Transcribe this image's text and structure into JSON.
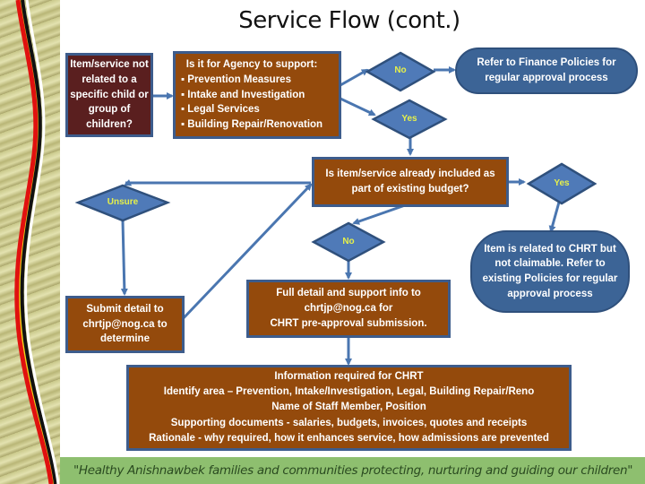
{
  "title": "Service Flow (cont.)",
  "colors": {
    "brown_box": "#944a0c",
    "maroon_box": "#5a1f1f",
    "blue_shape": "#3c6496",
    "diamond": "#4f7ab8",
    "diamond_text": "#e6f04a",
    "connector": "#4a76b0",
    "footer_bg": "#8ebf6f"
  },
  "nodes": {
    "start": {
      "text": "Item/service not related to a specific child or group of children?"
    },
    "agency_support": {
      "heading": "Is it for Agency to support:",
      "items": [
        "Prevention Measures",
        "Intake and Investigation",
        "Legal Services",
        "Building Repair/Renovation"
      ]
    },
    "no_top": {
      "label": "No"
    },
    "finance_policies": {
      "text": "Refer to Finance Policies for regular approval process"
    },
    "yes_top": {
      "label": "Yes"
    },
    "budget_question": {
      "text": "Is item/service already included as part of existing budget?"
    },
    "yes_right": {
      "label": "Yes"
    },
    "unsure": {
      "label": "Unsure"
    },
    "no_mid": {
      "label": "No"
    },
    "not_claimable": {
      "text": "Item is related to CHRT but not claimable. Refer to existing Policies for regular approval process"
    },
    "submit_detail": {
      "text": "Submit detail to chrtjp@nog.ca to determine"
    },
    "full_detail": {
      "lines": [
        "Full detail and support info to",
        "chrtjp@nog.ca for",
        "CHRT pre-approval submission."
      ]
    },
    "info_required": {
      "lines": [
        "Information required for CHRT",
        "Identify area – Prevention, Intake/Investigation,  Legal,  Building Repair/Reno",
        "Name of Staff Member, Position",
        "Supporting documents -  salaries, budgets, invoices, quotes and receipts",
        "Rationale -   why required, how it enhances service, how admissions are prevented"
      ]
    }
  },
  "footer": {
    "motto": "\"Healthy Anishnawbek families and communities protecting, nurturing and guiding our children\""
  }
}
